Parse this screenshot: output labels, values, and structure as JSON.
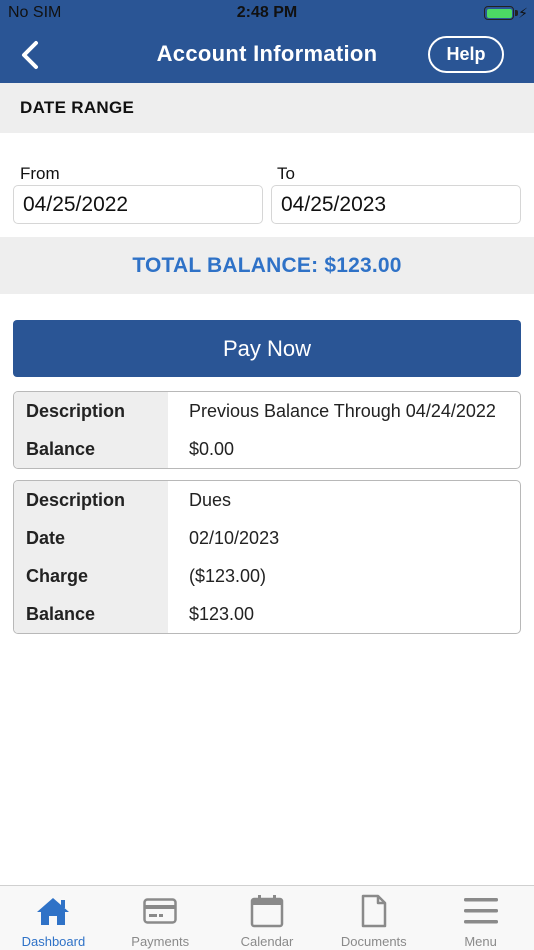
{
  "status_bar": {
    "carrier": "No SIM",
    "time": "2:48 PM"
  },
  "nav": {
    "title": "Account Information",
    "help_label": "Help",
    "back_icon": "chevron-left-icon"
  },
  "date_range": {
    "header": "DATE RANGE",
    "from_label": "From",
    "from_value": "04/25/2022",
    "to_label": "To",
    "to_value": "04/25/2023"
  },
  "total_balance": "TOTAL BALANCE: $123.00",
  "pay_now_label": "Pay Now",
  "transactions": [
    {
      "rows": [
        {
          "key": "Description",
          "value": "Previous Balance Through 04/24/2022"
        },
        {
          "key": "Balance",
          "value": "$0.00"
        }
      ]
    },
    {
      "rows": [
        {
          "key": "Description",
          "value": "Dues"
        },
        {
          "key": "Date",
          "value": "02/10/2023"
        },
        {
          "key": "Charge",
          "value": "($123.00)"
        },
        {
          "key": "Balance",
          "value": "$123.00"
        }
      ]
    }
  ],
  "tabs": [
    {
      "label": "Dashboard",
      "icon": "home-icon",
      "active": true
    },
    {
      "label": "Payments",
      "icon": "credit-card-icon",
      "active": false
    },
    {
      "label": "Calendar",
      "icon": "calendar-icon",
      "active": false
    },
    {
      "label": "Documents",
      "icon": "document-icon",
      "active": false
    },
    {
      "label": "Menu",
      "icon": "menu-icon",
      "active": false
    }
  ],
  "colors": {
    "brand": "#2a5595",
    "accent": "#2f72c7",
    "battery": "#4cd964",
    "inactive": "#8a8a8a"
  }
}
